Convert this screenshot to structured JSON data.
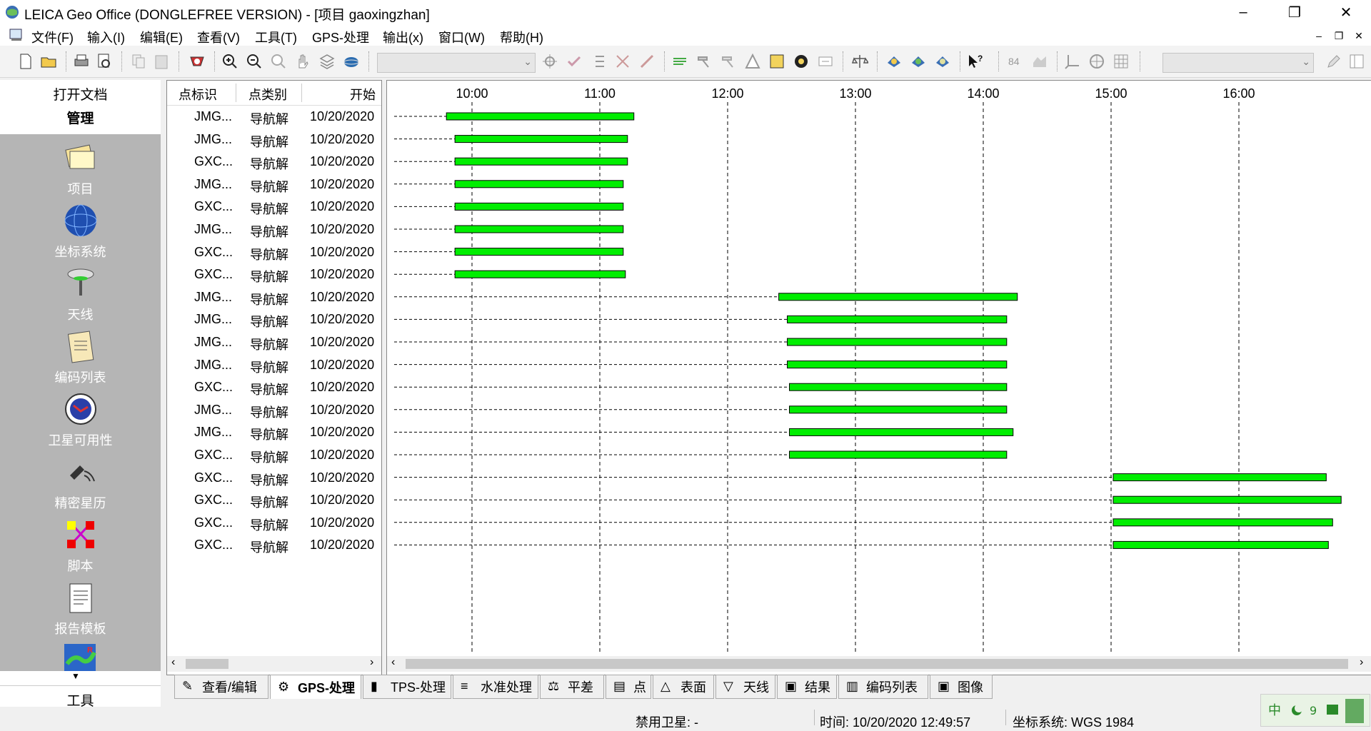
{
  "window": {
    "title": "LEICA Geo Office (DONGLEFREE VERSION) - [项目 gaoxingzhan]"
  },
  "menu": [
    "文件(F)",
    "输入(I)",
    "编辑(E)",
    "查看(V)",
    "工具(T)",
    "GPS-处理",
    "输出(x)",
    "窗口(W)",
    "帮助(H)"
  ],
  "sidebar": {
    "open_docs": "打开文档",
    "manage": "管理",
    "items": [
      {
        "label": "项目",
        "icon": "project-icon"
      },
      {
        "label": "坐标系统",
        "icon": "globe-icon"
      },
      {
        "label": "天线",
        "icon": "antenna-icon"
      },
      {
        "label": "编码列表",
        "icon": "codelist-icon"
      },
      {
        "label": "卫星可用性",
        "icon": "satellite-availability-icon"
      },
      {
        "label": "精密星历",
        "icon": "precise-ephemeris-icon"
      },
      {
        "label": "脚本",
        "icon": "script-icon"
      },
      {
        "label": "报告模板",
        "icon": "report-template-icon"
      }
    ],
    "tools": "工具"
  },
  "table": {
    "headers": [
      "点标识",
      "点类别",
      "开始"
    ],
    "rows": [
      {
        "id": "JMG...",
        "type": "导航解",
        "start": "10/20/2020"
      },
      {
        "id": "JMG...",
        "type": "导航解",
        "start": "10/20/2020"
      },
      {
        "id": "GXC...",
        "type": "导航解",
        "start": "10/20/2020"
      },
      {
        "id": "JMG...",
        "type": "导航解",
        "start": "10/20/2020"
      },
      {
        "id": "GXC...",
        "type": "导航解",
        "start": "10/20/2020"
      },
      {
        "id": "JMG...",
        "type": "导航解",
        "start": "10/20/2020"
      },
      {
        "id": "GXC...",
        "type": "导航解",
        "start": "10/20/2020"
      },
      {
        "id": "GXC...",
        "type": "导航解",
        "start": "10/20/2020"
      },
      {
        "id": "JMG...",
        "type": "导航解",
        "start": "10/20/2020"
      },
      {
        "id": "JMG...",
        "type": "导航解",
        "start": "10/20/2020"
      },
      {
        "id": "JMG...",
        "type": "导航解",
        "start": "10/20/2020"
      },
      {
        "id": "JMG...",
        "type": "导航解",
        "start": "10/20/2020"
      },
      {
        "id": "GXC...",
        "type": "导航解",
        "start": "10/20/2020"
      },
      {
        "id": "JMG...",
        "type": "导航解",
        "start": "10/20/2020"
      },
      {
        "id": "JMG...",
        "type": "导航解",
        "start": "10/20/2020"
      },
      {
        "id": "GXC...",
        "type": "导航解",
        "start": "10/20/2020"
      },
      {
        "id": "GXC...",
        "type": "导航解",
        "start": "10/20/2020"
      },
      {
        "id": "GXC...",
        "type": "导航解",
        "start": "10/20/2020"
      },
      {
        "id": "GXC...",
        "type": "导航解",
        "start": "10/20/2020"
      },
      {
        "id": "GXC...",
        "type": "导航解",
        "start": "10/20/2020"
      }
    ]
  },
  "timeline": {
    "ticks": [
      "10:00",
      "11:00",
      "12:00",
      "13:00",
      "14:00",
      "15:00",
      "16:00"
    ],
    "bar_color": "#00ee00",
    "sessions": [
      {
        "start": "09:48",
        "end": "11:16"
      },
      {
        "start": "09:52",
        "end": "11:13"
      },
      {
        "start": "09:52",
        "end": "11:13"
      },
      {
        "start": "09:52",
        "end": "11:11"
      },
      {
        "start": "09:52",
        "end": "11:11"
      },
      {
        "start": "09:52",
        "end": "11:11"
      },
      {
        "start": "09:52",
        "end": "11:11"
      },
      {
        "start": "09:52",
        "end": "11:12"
      },
      {
        "start": "12:24",
        "end": "14:16"
      },
      {
        "start": "12:28",
        "end": "14:11"
      },
      {
        "start": "12:28",
        "end": "14:11"
      },
      {
        "start": "12:28",
        "end": "14:11"
      },
      {
        "start": "12:29",
        "end": "14:11"
      },
      {
        "start": "12:29",
        "end": "14:11"
      },
      {
        "start": "12:29",
        "end": "14:14"
      },
      {
        "start": "12:29",
        "end": "14:11"
      },
      {
        "start": "15:01",
        "end": "16:41"
      },
      {
        "start": "15:01",
        "end": "16:48"
      },
      {
        "start": "15:01",
        "end": "16:44"
      },
      {
        "start": "15:01",
        "end": "16:42"
      }
    ]
  },
  "tabs": [
    "查看/编辑",
    "GPS-处理",
    "TPS-处理",
    "水准处理",
    "平差",
    "点",
    "表面",
    "天线",
    "结果",
    "编码列表",
    "图像"
  ],
  "status": {
    "disabled_sats": "禁用卫星: -",
    "time": "时间: 10/20/2020 12:49:57",
    "coord_sys": "坐标系统: WGS 1984"
  },
  "colors": {
    "accent_green": "#00ee00",
    "sidebar_gray": "#b5b5b5"
  }
}
